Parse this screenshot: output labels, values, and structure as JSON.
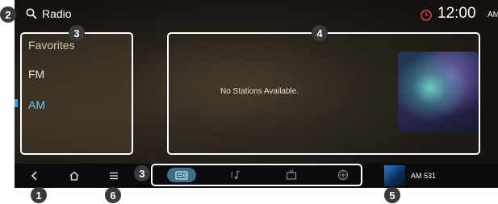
{
  "header": {
    "title": "Radio",
    "time": "12:00",
    "ampm": "AM"
  },
  "sidebar": {
    "items": [
      {
        "label": "Favorites"
      },
      {
        "label": "FM"
      },
      {
        "label": "AM"
      }
    ]
  },
  "main": {
    "empty_message": "No Stations Available."
  },
  "now_playing": {
    "label": "AM 531"
  },
  "callouts": [
    "1",
    "2",
    "3",
    "4",
    "5",
    "6"
  ],
  "colors": {
    "accent": "#3aa7e8",
    "selected_tab": "#3b6f86",
    "callout": "#3a3a3a"
  },
  "icons": {
    "search": "search-icon",
    "clock": "clock-icon",
    "back": "back-icon",
    "home": "home-icon",
    "menu": "menu-icon",
    "radio_tab": "radio-icon",
    "music_tab": "music-icon",
    "tv_tab": "tv-icon",
    "more_tab": "apps-icon"
  }
}
